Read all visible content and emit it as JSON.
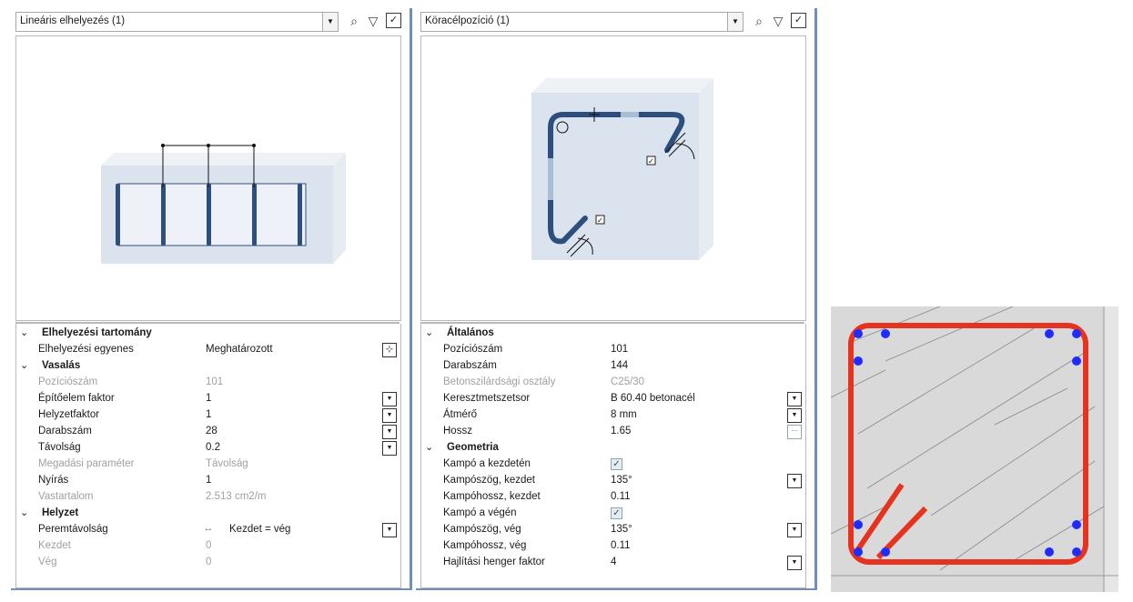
{
  "left_panel": {
    "title": "Lineáris elhelyezés (1)",
    "groups": [
      {
        "title": "Elhelyezési tartomány",
        "rows": [
          {
            "label": "Elhelyezési egyenes",
            "value": "Meghatározott",
            "disabled": false
          }
        ]
      },
      {
        "title": "Vasalás",
        "rows": [
          {
            "label": "Pozíciószám",
            "value": "101",
            "disabled": true
          },
          {
            "label": "Építőelem faktor",
            "value": "1",
            "disabled": false
          },
          {
            "label": "Helyzetfaktor",
            "value": "1",
            "disabled": false
          },
          {
            "label": "Darabszám",
            "value": "28",
            "disabled": false
          },
          {
            "label": "Távolság",
            "value": "0.2",
            "disabled": false
          },
          {
            "label": "Megadási paraméter",
            "value": "Távolság",
            "disabled": true
          },
          {
            "label": "Nyírás",
            "value": "1",
            "disabled": false
          },
          {
            "label": "Vastartalom",
            "value": "2.513 cm2/m",
            "disabled": true
          }
        ]
      },
      {
        "title": "Helyzet",
        "rows": [
          {
            "label": "Peremtávolság",
            "value": "Kezdet = vég",
            "disabled": false
          },
          {
            "label": "Kezdet",
            "value": "0",
            "disabled": true
          },
          {
            "label": "Vég",
            "value": "0",
            "disabled": true
          }
        ]
      }
    ]
  },
  "right_panel": {
    "title": "Köracélpozíció (1)",
    "groups": [
      {
        "title": "Általános",
        "rows": [
          {
            "label": "Pozíciószám",
            "value": "101",
            "disabled": false
          },
          {
            "label": "Darabszám",
            "value": "144",
            "disabled": false
          },
          {
            "label": "Betonszilárdsági osztály",
            "value": "C25/30",
            "disabled": true
          },
          {
            "label": "Keresztmetszetsor",
            "value": "B 60.40 betonacél",
            "disabled": false
          },
          {
            "label": "Átmérő",
            "value": "8 mm",
            "disabled": false
          },
          {
            "label": "Hossz",
            "value": "1.65",
            "disabled": false
          }
        ]
      },
      {
        "title": "Geometria",
        "rows": [
          {
            "label": "Kampó a kezdetén",
            "value": "",
            "disabled": false
          },
          {
            "label": "Kampószög, kezdet",
            "value": "135°",
            "disabled": false
          },
          {
            "label": "Kampóhossz, kezdet",
            "value": "0.11",
            "disabled": false
          },
          {
            "label": "Kampó a végén",
            "value": "",
            "disabled": false
          },
          {
            "label": "Kampószög, vég",
            "value": "135°",
            "disabled": false
          },
          {
            "label": "Kampóhossz, vég",
            "value": "0.11",
            "disabled": false
          },
          {
            "label": "Hajlítási henger faktor",
            "value": "4",
            "disabled": false
          }
        ]
      }
    ]
  },
  "icons": {
    "dropdown": "chevron-down-icon",
    "zoom": "zoom-icon",
    "filter": "filter-icon",
    "check": "checkbox-icon",
    "ellipsis": "ellipsis-icon"
  },
  "colors": {
    "rebar": "#2e4f7e",
    "concrete": "#dbe3ee",
    "stirrup_red": "#e5331f",
    "bar_blue": "#1f2cff",
    "frame": "#6e8fb8"
  }
}
